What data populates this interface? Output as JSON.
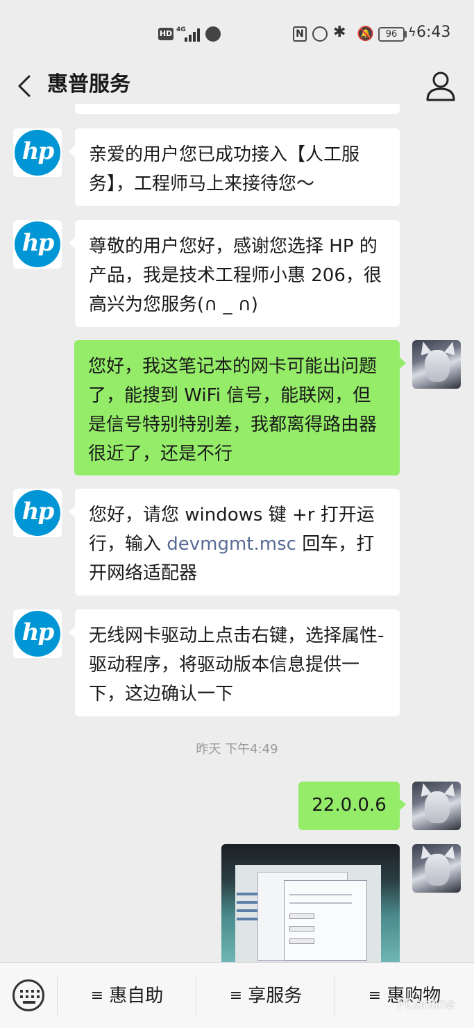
{
  "status_bar": {
    "hd": "HD",
    "network": "4G",
    "battery": "96",
    "time": "6:43"
  },
  "nav": {
    "title": "惠普服务"
  },
  "messages": [
    {
      "from": "hp",
      "text": "亲爱的用户您已成功接入【人工服务】，工程师马上来接待您～"
    },
    {
      "from": "hp",
      "text": "尊敬的用户您好，感谢您选择 HP 的产品，我是技术工程师小惠 206，很高兴为您服务(∩ _ ∩)"
    },
    {
      "from": "user",
      "text": "您好，我这笔记本的网卡可能出问题了，能搜到 WiFi 信号，能联网，但是信号特别特别差，我都离得路由器很近了，还是不行"
    },
    {
      "from": "hp",
      "text_before": "您好，请您 windows 键 +r 打开运行，输入 ",
      "link": "devmgmt.msc",
      "text_after": " 回车，打开网络适配器"
    },
    {
      "from": "hp",
      "text": "无线网卡驱动上点击右键，选择属性-驱动程序，将驱动版本信息提供一下，这边确认一下"
    },
    {
      "from": "user",
      "text": "22.0.0.6"
    }
  ],
  "timestamp": "昨天 下午4:49",
  "hp_logo_text": "hp",
  "bottom_menu": [
    {
      "label": "惠自助"
    },
    {
      "label": "享服务"
    },
    {
      "label": "惠购物"
    }
  ],
  "menu_glyph": "≡",
  "watermark": "PConline",
  "colors": {
    "background": "#ededed",
    "outgoing_bubble": "#95ec69",
    "incoming_bubble": "#ffffff",
    "hp_blue": "#0096d6",
    "link": "#576b95"
  }
}
